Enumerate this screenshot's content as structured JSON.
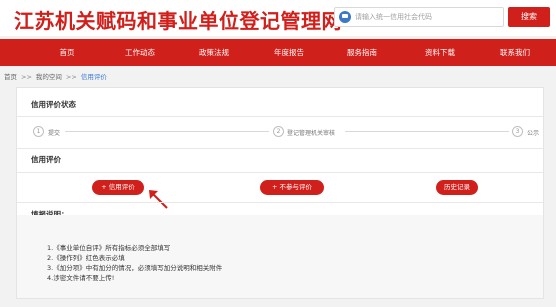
{
  "header": {
    "site_title": "江苏机关赋码和事业单位登记管理网",
    "search_placeholder": "请输入统一信用社会代码",
    "search_button": "搜索"
  },
  "nav": {
    "items": [
      "首页",
      "工作动态",
      "政策法规",
      "年度报告",
      "服务指南",
      "资料下载",
      "联系我们"
    ]
  },
  "breadcrumb": {
    "items": [
      "首页",
      "我的空间",
      "信用评价"
    ],
    "separator": ">>"
  },
  "status_section": {
    "title": "信用评价状态",
    "steps": [
      {
        "num": "1",
        "label": "提交"
      },
      {
        "num": "2",
        "label": "登记管理机关审核"
      },
      {
        "num": "3",
        "label": "公示"
      }
    ]
  },
  "evaluation_section": {
    "title": "信用评价",
    "buttons": {
      "credit": "+ 信用评价",
      "not_participate": "+ 不参与评价",
      "history": "历史记录"
    }
  },
  "notes": {
    "title": "填报说明：",
    "lines": [
      "1.《事业单位自评》所有指标必须全部填写",
      "2.《操作列》红色表示必填",
      "3.《加分项》中有加分的情况，必须填写加分说明和相关附件",
      "4.涉密文件请不要上传!"
    ]
  },
  "colors": {
    "brand_red": "#d0201c",
    "link_blue": "#3a7bd5"
  }
}
